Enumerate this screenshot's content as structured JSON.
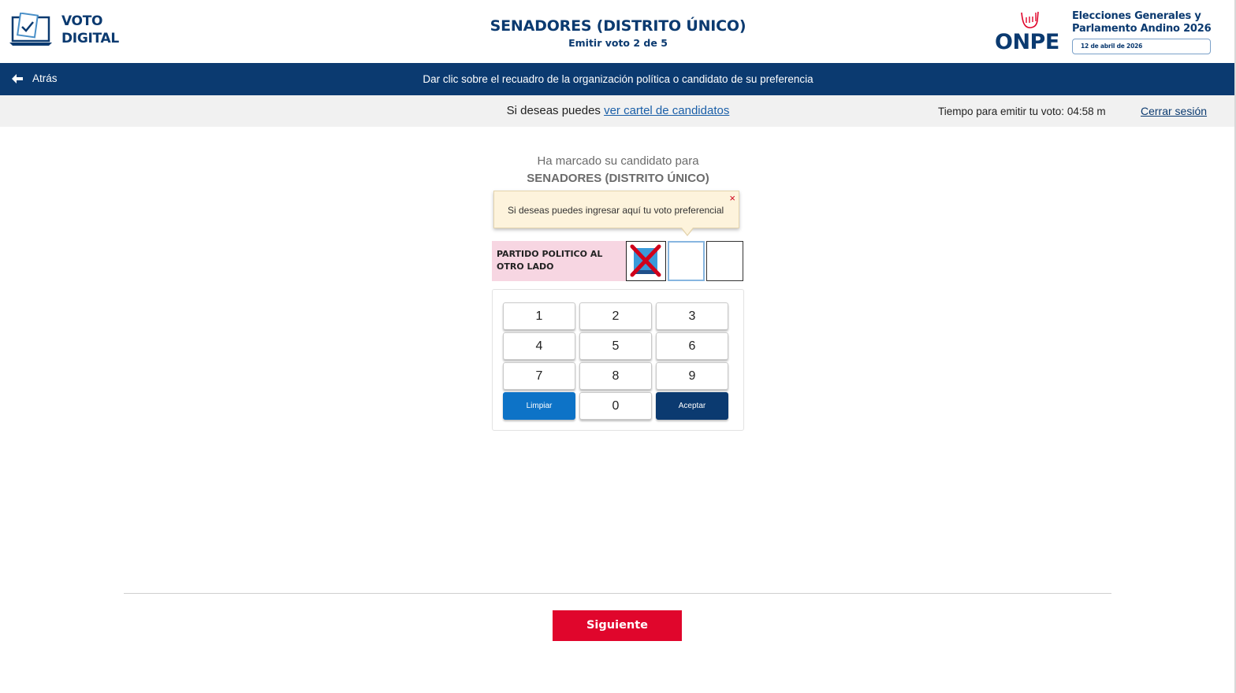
{
  "brand": {
    "voto_line1": "VOTO",
    "voto_line2": "DIGITAL",
    "onpe": "ONPE",
    "elections_line1": "Elecciones Generales y",
    "elections_line2": "Parlamento Andino 2026",
    "election_date": "12 de abril de 2026"
  },
  "header": {
    "title": "SENADORES (DISTRITO ÚNICO)",
    "subtitle": "Emitir voto 2 de 5"
  },
  "navbar": {
    "back_label": "Atrás",
    "instruction": "Dar clic sobre el recuadro de la organización política o candidato de su preferencia"
  },
  "infobar": {
    "prefix": "Si deseas puedes ",
    "link": "ver cartel de candidatos",
    "timer": "Tiempo para emitir tu voto: 04:58 m",
    "logout": "Cerrar sesión"
  },
  "content": {
    "marked_line1": "Ha marcado su candidato para",
    "marked_line2": "SENADORES (DISTRITO ÚNICO)",
    "tooltip": "Si deseas puedes ingresar aquí tu voto preferencial",
    "tooltip_close": "×",
    "party_name": "PARTIDO POLITICO AL OTRO LADO"
  },
  "keypad": {
    "keys": [
      "1",
      "2",
      "3",
      "4",
      "5",
      "6",
      "7",
      "8",
      "9"
    ],
    "clear": "Limpiar",
    "zero": "0",
    "accept": "Aceptar"
  },
  "footer": {
    "next": "Siguiente"
  },
  "colors": {
    "navy": "#0b3a70",
    "red": "#e0062c",
    "blue": "#0d73c7",
    "party_bg": "#f7d6e2",
    "tooltip_bg": "#fdf3dc"
  }
}
